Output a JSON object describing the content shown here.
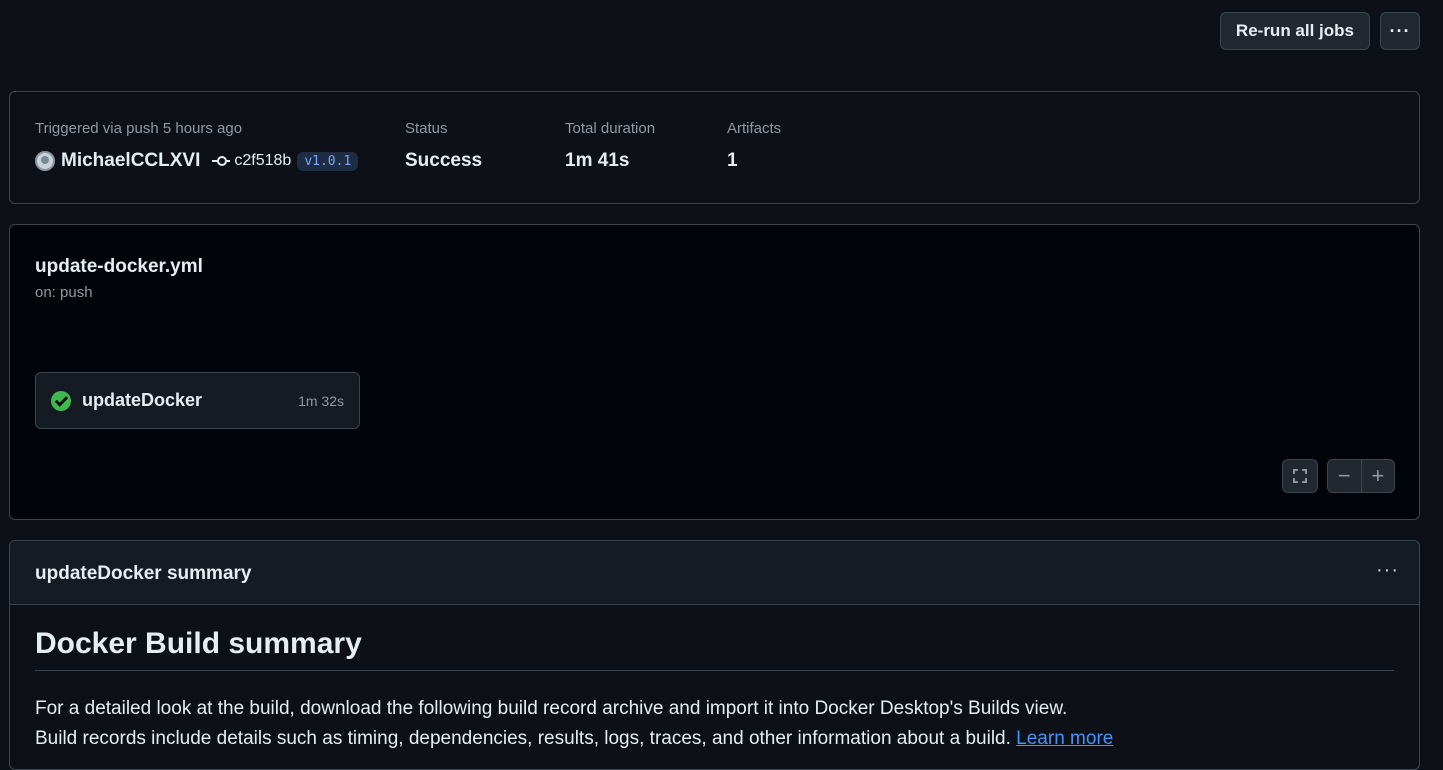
{
  "toolbar": {
    "rerun_label": "Re-run all jobs",
    "more_label": "···"
  },
  "run_info": {
    "trigger_label": "Triggered via push 5 hours ago",
    "actor": "MichaelCCLXVI",
    "commit_sha": "c2f518b",
    "tag": "v1.0.1",
    "status_label": "Status",
    "status_value": "Success",
    "duration_label": "Total duration",
    "duration_value": "1m 41s",
    "artifacts_label": "Artifacts",
    "artifacts_value": "1"
  },
  "workflow": {
    "file": "update-docker.yml",
    "trigger": "on: push",
    "job": {
      "name": "updateDocker",
      "duration": "1m 32s",
      "status": "success"
    },
    "zoom_out": "−",
    "zoom_in": "+"
  },
  "summary": {
    "title": "updateDocker summary",
    "more_label": "···",
    "heading": "Docker Build summary",
    "line1": "For a detailed look at the build, download the following build record archive and import it into Docker Desktop's Builds view.",
    "line2": "Build records include details such as timing, dependencies, results, logs, traces, and other information about a build.",
    "link": "Learn more"
  },
  "colors": {
    "success": "#3fb950",
    "link": "#4493f8",
    "tag_bg": "#1f2d44",
    "tag_fg": "#79a5f5"
  }
}
